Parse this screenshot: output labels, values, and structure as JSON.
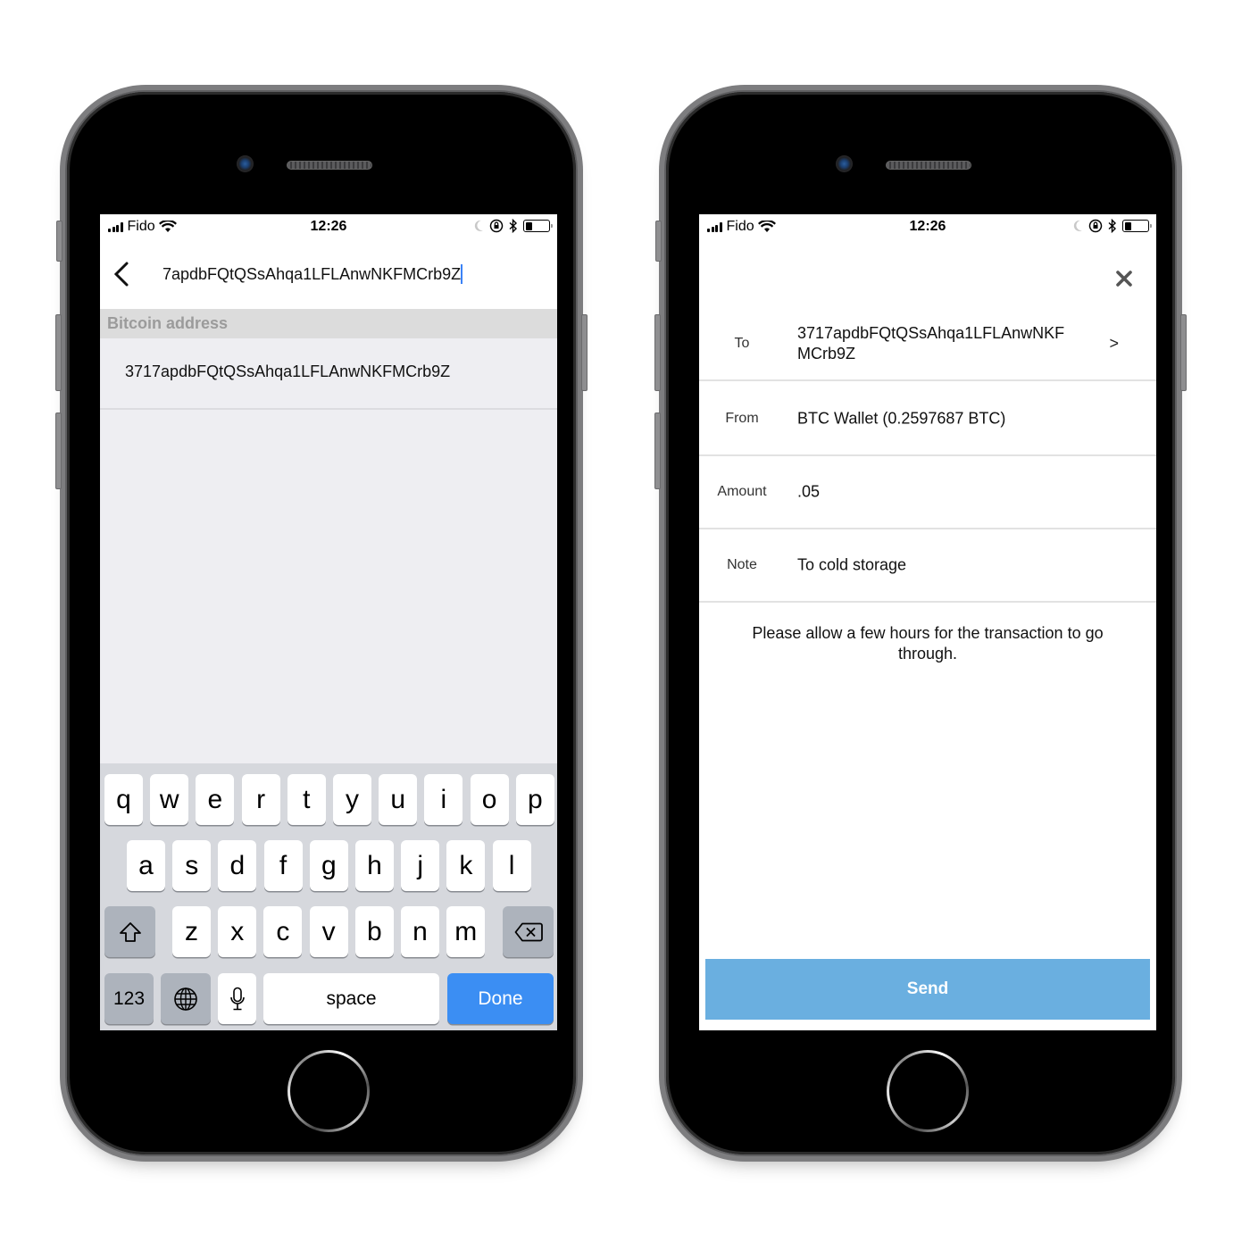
{
  "status_bar": {
    "carrier": "Fido",
    "time": "12:26",
    "battery_level": 0.3
  },
  "search_screen": {
    "search_value": "7apdbFQtQSsAhqa1LFLAnwNKFMCrb9Z",
    "section_header": "Bitcoin address",
    "results": [
      {
        "address": "3717apdbFQtQSsAhqa1LFLAnwNKFMCrb9Z"
      }
    ],
    "keyboard": {
      "row1": [
        "q",
        "w",
        "e",
        "r",
        "t",
        "y",
        "u",
        "i",
        "o",
        "p"
      ],
      "row2": [
        "a",
        "s",
        "d",
        "f",
        "g",
        "h",
        "j",
        "k",
        "l"
      ],
      "row3": [
        "z",
        "x",
        "c",
        "v",
        "b",
        "n",
        "m"
      ],
      "numbers_label": "123",
      "space_label": "space",
      "done_label": "Done"
    }
  },
  "send_screen": {
    "fields": [
      {
        "label": "To",
        "value": "3717apdbFQtQSsAhqa1LFLAnwNKFMCrb9Z",
        "chevron": ">"
      },
      {
        "label": "From",
        "value": "BTC Wallet (0.2597687 BTC)"
      },
      {
        "label": "Amount",
        "value": ".05"
      },
      {
        "label": "Note",
        "value": "To cold storage"
      }
    ],
    "info_text": "Please allow a few hours for the transaction to go through.",
    "send_label": "Send"
  },
  "colors": {
    "send_button": "#6aafe0",
    "done_key": "#3b8ef3",
    "caret": "#3b82f6",
    "section_header_bg": "#dcdcdc",
    "results_bg": "#eeeef2"
  }
}
